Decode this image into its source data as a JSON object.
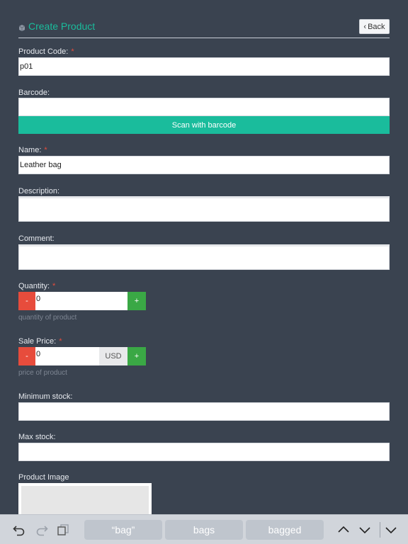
{
  "header": {
    "title": "Create Product",
    "back_label": "Back"
  },
  "form": {
    "product_code": {
      "label": "Product Code:",
      "required": "*",
      "value": "p01"
    },
    "barcode": {
      "label": "Barcode:",
      "value": "",
      "scan_label": "Scan with barcode"
    },
    "name": {
      "label": "Name:",
      "required": "*",
      "value": "Leather bag"
    },
    "description": {
      "label": "Description:",
      "value": ""
    },
    "comment": {
      "label": "Comment:",
      "value": ""
    },
    "quantity": {
      "label": "Quantity:",
      "required": "*",
      "value": "0",
      "minus": "-",
      "plus": "+",
      "hint": "quantity of product"
    },
    "sale_price": {
      "label": "Sale Price:",
      "required": "*",
      "value": "0",
      "currency": "USD",
      "minus": "-",
      "plus": "+",
      "hint": "price of product"
    },
    "minimum_stock": {
      "label": "Minimum stock:",
      "value": ""
    },
    "max_stock": {
      "label": "Max stock:",
      "value": ""
    },
    "product_image": {
      "label": "Product Image"
    }
  },
  "keyboard_bar": {
    "suggestions": [
      "“bag”",
      "bags",
      "bagged"
    ],
    "icons": [
      "undo-icon",
      "redo-icon",
      "paste-icon",
      "chevron-up-icon",
      "chevron-down-icon",
      "dismiss-keyboard-icon"
    ]
  },
  "colors": {
    "accent": "#1abc9c",
    "background": "#3a4350",
    "danger": "#e74c3c",
    "success": "#3aa845",
    "required": "#e74c3c"
  }
}
